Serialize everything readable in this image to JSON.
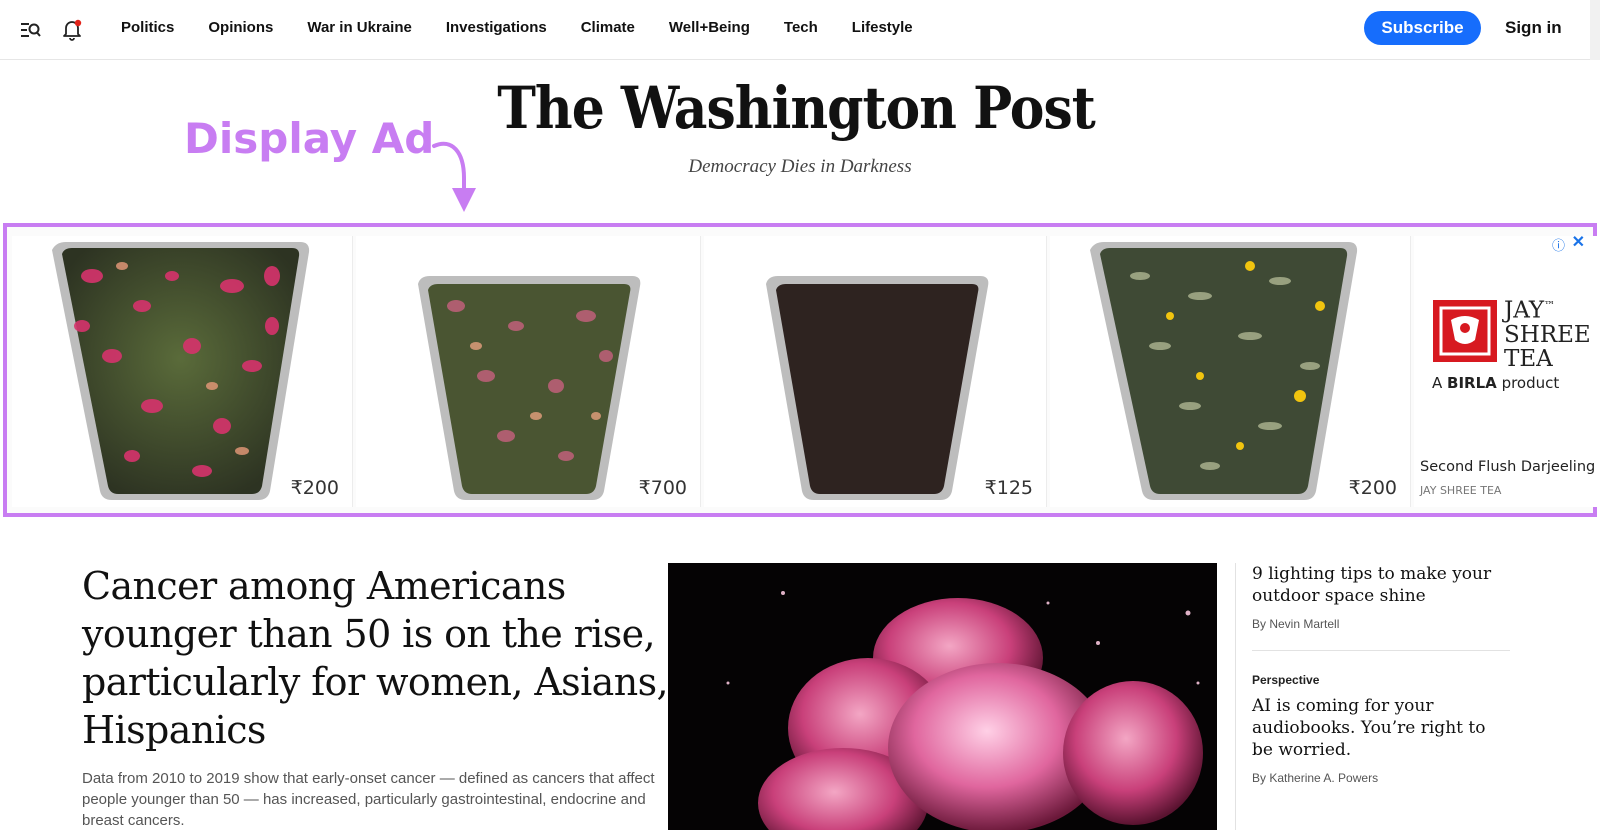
{
  "nav": {
    "links": [
      "Politics",
      "Opinions",
      "War in Ukraine",
      "Investigations",
      "Climate",
      "Well+Being",
      "Tech",
      "Lifestyle"
    ],
    "subscribe": "Subscribe",
    "sign_in": "Sign in",
    "menu_icon": "search-menu-icon",
    "bell_icon": "notification-bell-icon",
    "accent": "#166dfc"
  },
  "masthead": {
    "logo": "The Washington Post",
    "tagline": "Democracy Dies in Darkness"
  },
  "annotation": {
    "label": "Display Ad",
    "color": "#c87df2"
  },
  "ad": {
    "tiles": [
      {
        "price": "₹200",
        "image": "rose-green-tea-leaves"
      },
      {
        "price": "₹700",
        "image": "rose-tea-leaves"
      },
      {
        "price": "₹125",
        "image": "black-tea-powder"
      },
      {
        "price": "₹200",
        "image": "darjeeling-tea-leaves"
      }
    ],
    "brand": {
      "line1": "JAY",
      "tm": "™",
      "line2": "SHREE",
      "line3": "TEA",
      "sub_prefix": "A",
      "sub_bold": "BIRLA",
      "sub_suffix": "product"
    },
    "product_name": "Second Flush Darjeeling",
    "advertiser": "JAY SHREE TEA",
    "info_icon": "ⓘ",
    "close_icon": "✕"
  },
  "main_story": {
    "headline": "Cancer among Americans younger than 50 is on the rise, particularly for women, Asians, Hispanics",
    "dek": "Data from 2010 to 2019 show that early-onset cancer — defined as cancers that affect people younger than 50 — has increased, particularly gastrointestinal, endocrine and breast cancers.",
    "image": "cancer-cells-illustration"
  },
  "rail": [
    {
      "kicker": "",
      "title": "9 lighting tips to make your outdoor space shine",
      "byline": "By Nevin Martell"
    },
    {
      "kicker": "Perspective",
      "title": "AI is coming for your audiobooks. You’re right to be worried.",
      "byline": "By Katherine A. Powers"
    }
  ]
}
